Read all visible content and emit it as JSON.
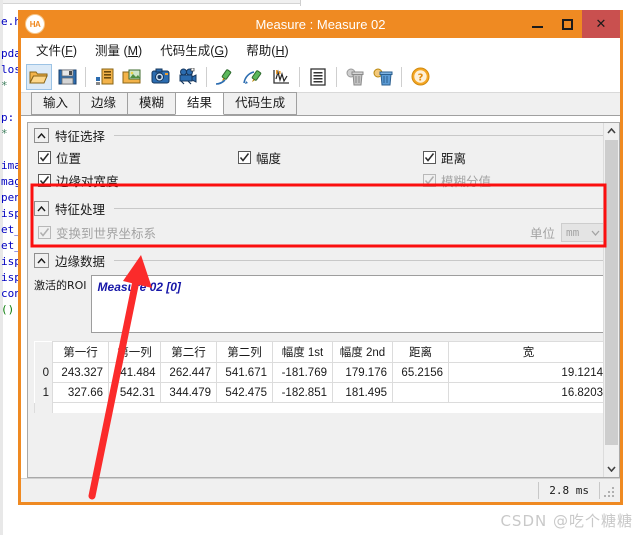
{
  "backdrop": {
    "code_lines": [
      "e.h",
      "",
      "pda",
      "los",
      "*",
      "",
      "p:",
      "*",
      "",
      "ima",
      "mag",
      "pen",
      "isp",
      "et_",
      "et_",
      "isp",
      "isp",
      "con",
      "()"
    ]
  },
  "window": {
    "title": "Measure : Measure 02",
    "app_icon": "halcon-ha-icon",
    "controls": {
      "minimize": "minimize-icon",
      "maximize": "maximize-icon",
      "close": "✕"
    }
  },
  "menubar": {
    "items": [
      {
        "text": "文件(",
        "mnemonic": "F",
        "tail": ")"
      },
      {
        "text": "测量 (",
        "mnemonic": "M",
        "tail": ")"
      },
      {
        "text": "代码生成(",
        "mnemonic": "G",
        "tail": ")"
      },
      {
        "text": "帮助(",
        "mnemonic": "H",
        "tail": ")"
      }
    ]
  },
  "toolbar": {
    "buttons": [
      {
        "name": "open-file-button",
        "icon": "folder-open-icon",
        "selected": true
      },
      {
        "name": "save-file-button",
        "icon": "floppy-save-icon",
        "selected": false
      },
      {
        "name": "export-settings-button",
        "icon": "export-list-icon",
        "selected": false
      },
      {
        "name": "load-image-button",
        "icon": "folder-image-icon",
        "selected": false
      },
      {
        "name": "grab-image-button",
        "icon": "camera-icon",
        "selected": false
      },
      {
        "name": "live-video-button",
        "icon": "video-camera-icon",
        "selected": false
      },
      {
        "name": "draw-roi-button",
        "icon": "pencil-line-icon",
        "selected": false
      },
      {
        "name": "draw-arc-roi-button",
        "icon": "pencil-arc-icon",
        "selected": false
      },
      {
        "name": "show-profile-button",
        "icon": "chart-plot-icon",
        "selected": false
      },
      {
        "name": "show-results-button",
        "icon": "document-lines-icon",
        "selected": false
      },
      {
        "name": "delete-roi-button",
        "icon": "trash-gray-icon",
        "selected": false
      },
      {
        "name": "delete-all-rois-button",
        "icon": "trash-blue-icon",
        "selected": false
      },
      {
        "name": "help-button",
        "icon": "question-circle-icon",
        "selected": false
      }
    ]
  },
  "tabs": [
    {
      "label": "输入",
      "active": false
    },
    {
      "label": "边缘",
      "active": false
    },
    {
      "label": "模糊",
      "active": false
    },
    {
      "label": "结果",
      "active": true
    },
    {
      "label": "代码生成",
      "active": false
    }
  ],
  "groups": {
    "feature_selection": {
      "title": "特征选择",
      "collapse_icon": "chevron-up-icon",
      "checkboxes": [
        {
          "label": "位置",
          "checked": true,
          "disabled": false
        },
        {
          "label": "幅度",
          "checked": true,
          "disabled": false
        },
        {
          "label": "距离",
          "checked": true,
          "disabled": false
        },
        {
          "label": "边缘对宽度",
          "checked": true,
          "disabled": false
        },
        {
          "label": "模糊分值",
          "checked": true,
          "disabled": true
        }
      ]
    },
    "feature_processing": {
      "title": "特征处理",
      "collapse_icon": "chevron-up-icon",
      "world_coord": {
        "label": "变换到世界坐标系",
        "checked": true,
        "disabled": true
      },
      "unit_label": "单位",
      "unit_value": "mm",
      "unit_caret": "chevron-down-icon"
    },
    "edge_data": {
      "title": "边缘数据",
      "collapse_icon": "chevron-up-icon"
    }
  },
  "roi": {
    "label": "激活的ROI",
    "entries": [
      "Measure 02 [0]"
    ]
  },
  "table": {
    "columns": [
      "第一行",
      "第一列",
      "第二行",
      "第二列",
      "幅度 1st",
      "幅度 2nd",
      "距离",
      "宽"
    ],
    "rows": [
      {
        "index": "0",
        "cells": [
          "243.327",
          "541.484",
          "262.447",
          "541.671",
          "-181.769",
          "179.176",
          "65.2156",
          "19.1214"
        ]
      },
      {
        "index": "1",
        "cells": [
          "327.66",
          "542.31",
          "344.479",
          "542.475",
          "-182.851",
          "181.495",
          "",
          "16.8203"
        ]
      }
    ]
  },
  "statusbar": {
    "time": "2.8 ms",
    "grip": "resize-grip-icon"
  },
  "annotations": {
    "highlight_box_color": "#fb0f0f",
    "arrow_color": "#fb2b2b"
  },
  "watermark": "CSDN @吃个糖糖",
  "colors": {
    "titlebar": "#ef8a22",
    "close_button": "#c9504f",
    "panel_bg": "#f0f0f0",
    "roi_text": "#1616a8"
  }
}
